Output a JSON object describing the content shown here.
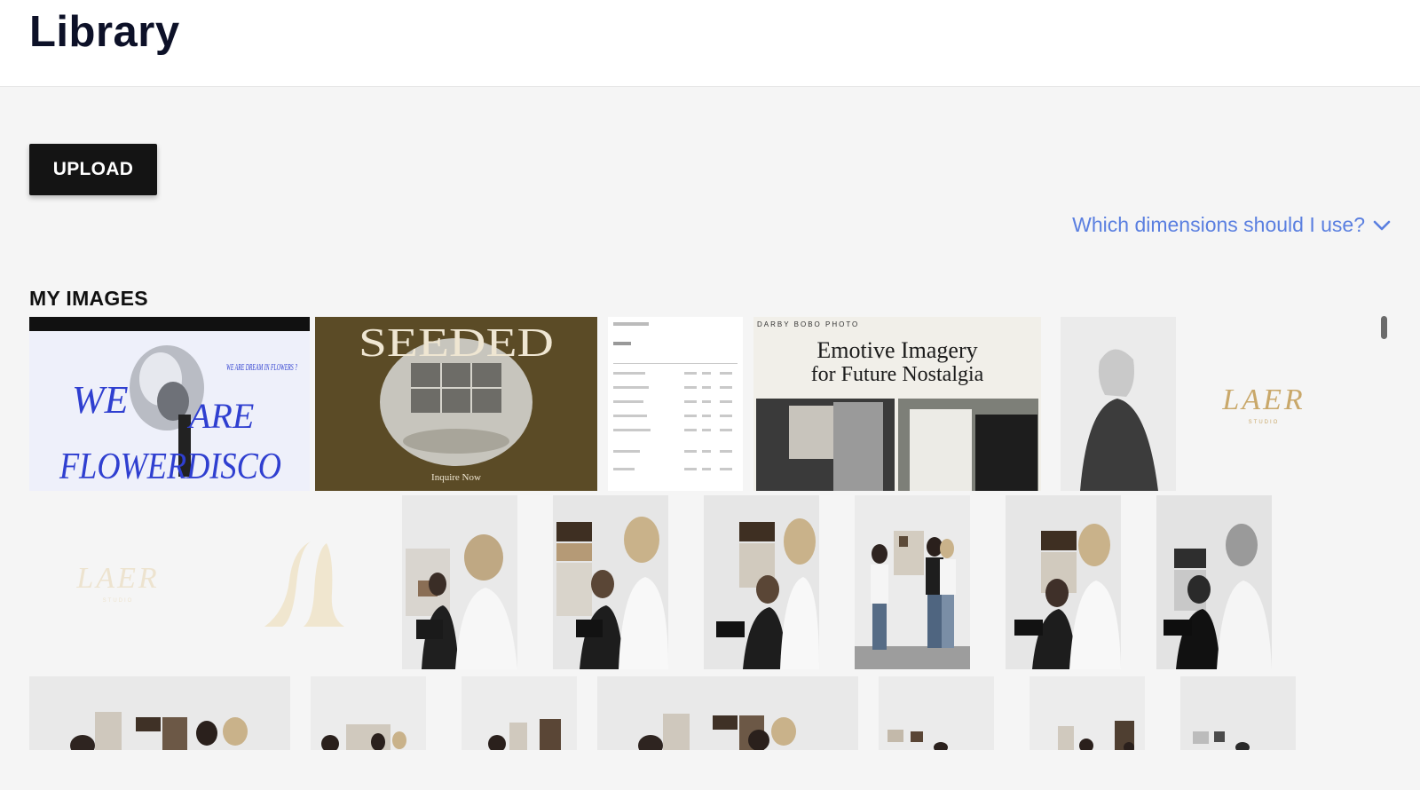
{
  "header": {
    "title": "Library"
  },
  "toolbar": {
    "upload_label": "UPLOAD"
  },
  "help": {
    "dimensions_link": "Which dimensions should I use?"
  },
  "section": {
    "title": "MY IMAGES"
  },
  "images": {
    "flowerdisco": {
      "line1": "WE",
      "line2": "ARE",
      "line3": "FLOWERDISCO",
      "tag": "WE ARE DREAM IN FLOWERS ?"
    },
    "seeded": {
      "title": "SEEDED",
      "caption": "Inquire Now"
    },
    "darby": {
      "brand": "DARBY BOBO PHOTO",
      "headline1": "Emotive Imagery",
      "headline2": "for Future Nostalgia"
    },
    "laer1": {
      "text": "LAER",
      "sub": "STUDIO"
    },
    "laer2": {
      "text": "LAER",
      "sub": "STUDIO"
    }
  },
  "colors": {
    "link": "#5a7fe0",
    "button_bg": "#141414",
    "olive": "#5a4a25",
    "gold": "#c9a86a"
  }
}
